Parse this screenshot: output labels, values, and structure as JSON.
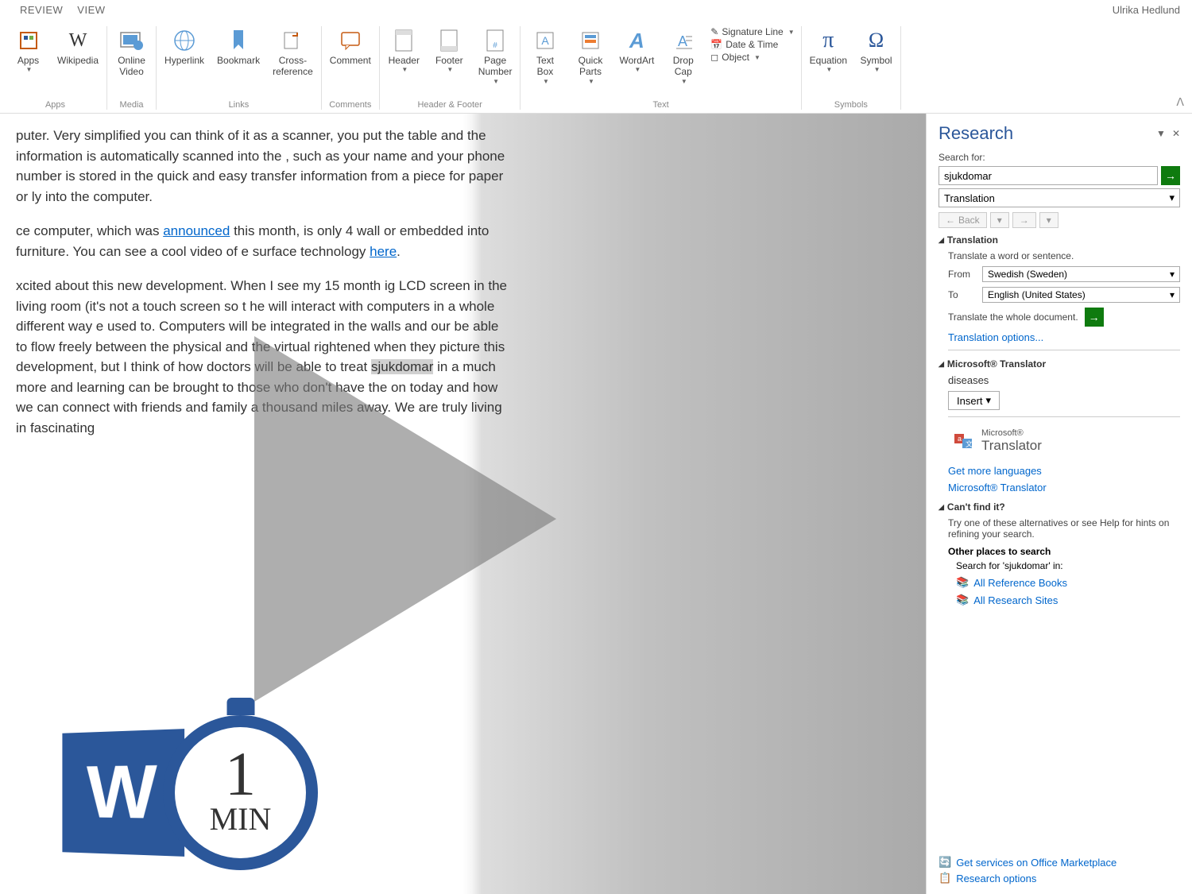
{
  "tabs": {
    "review": "REVIEW",
    "view": "VIEW"
  },
  "username": "Ulrika Hedlund",
  "ribbon": {
    "apps": {
      "label": "Apps",
      "apps_btn": "Apps",
      "wikipedia": "Wikipedia"
    },
    "media": {
      "label": "Media",
      "online_video": "Online\nVideo"
    },
    "links": {
      "label": "Links",
      "hyperlink": "Hyperlink",
      "bookmark": "Bookmark",
      "crossref": "Cross-\nreference"
    },
    "comments": {
      "label": "Comments",
      "comment": "Comment"
    },
    "headerfooter": {
      "label": "Header & Footer",
      "header": "Header",
      "footer": "Footer",
      "pagenum": "Page\nNumber"
    },
    "text": {
      "label": "Text",
      "textbox": "Text\nBox",
      "quickparts": "Quick\nParts",
      "wordart": "WordArt",
      "dropcap": "Drop\nCap",
      "sigline": "Signature Line",
      "datetime": "Date & Time",
      "object": "Object"
    },
    "symbols": {
      "label": "Symbols",
      "equation": "Equation",
      "symbol": "Symbol"
    }
  },
  "document": {
    "p1": "puter. Very simplified you can think of it as a scanner, you put the table and the information is automatically scanned into the , such as your name and your phone number is stored in the quick and easy transfer information from a piece for paper or ly into the computer.",
    "p2a": "ce computer, which was ",
    "p2link1": "announced",
    "p2b": " this month, is only 4 wall or embedded into furniture.  You can see a cool video of e surface technology ",
    "p2link2": "here",
    "p2c": ".",
    "p3a": "xcited about this new development. When I see my 15 month ig LCD screen in the living room (it's not a touch screen so t he will interact with computers in a whole different way e used to. Computers will be integrated in the walls and our be able to flow freely between the physical and the virtual rightened when they picture this development, but I think of how doctors will be able to treat ",
    "p3highlight": "sjukdomar",
    "p3b": " in a much more and learning can be brought to those who don't have the on today and how we can connect with friends and family a thousand miles away. We are truly living in fascinating"
  },
  "research": {
    "title": "Research",
    "search_for": "Search for:",
    "search_value": "sjukdomar",
    "service": "Translation",
    "back": "Back",
    "translation_header": "Translation",
    "translate_prompt": "Translate a word or sentence.",
    "from_label": "From",
    "from_value": "Swedish (Sweden)",
    "to_label": "To",
    "to_value": "English (United States)",
    "whole_doc": "Translate the whole document.",
    "options": "Translation options...",
    "translator_header": "Microsoft® Translator",
    "result": "diseases",
    "insert": "Insert",
    "logo_small": "Microsoft®",
    "logo_main": "Translator",
    "more_langs": "Get more languages",
    "ms_translator": "Microsoft® Translator",
    "cant_find": "Can't find it?",
    "alternatives": "Try one of these alternatives or see Help for hints on refining your search.",
    "other_places": "Other places to search",
    "search_in": "Search for 'sjukdomar' in:",
    "ref_books": "All Reference Books",
    "research_sites": "All Research Sites",
    "marketplace": "Get services on Office Marketplace",
    "research_opts": "Research options"
  },
  "badge": {
    "one": "1",
    "min": "MIN"
  }
}
